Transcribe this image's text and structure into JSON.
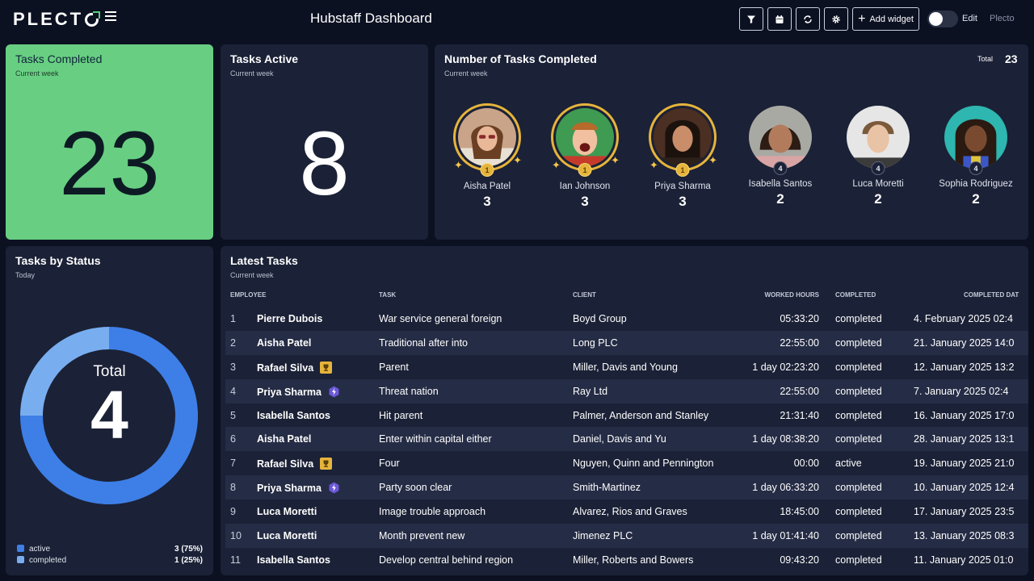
{
  "app": {
    "logo": "PLECTO",
    "dashboard_title": "Hubstaff Dashboard",
    "toolbar": {
      "filter_icon": "filter-icon",
      "calendar_icon": "calendar-icon",
      "refresh_icon": "refresh-icon",
      "settings_icon": "gear-icon",
      "add_widget_label": "Add widget",
      "edit_label": "Edit",
      "brand_label": "Plecto"
    }
  },
  "tasks_completed": {
    "title": "Tasks Completed",
    "subtitle": "Current week",
    "value": "23",
    "color": "#68cf82"
  },
  "tasks_active": {
    "title": "Tasks Active",
    "subtitle": "Current week",
    "value": "8"
  },
  "leaderboard": {
    "title": "Number of Tasks Completed",
    "subtitle": "Current week",
    "total_label": "Total",
    "total_value": "23",
    "people": [
      {
        "name": "Aisha Patel",
        "value": "3",
        "rank": "1"
      },
      {
        "name": "Ian Johnson",
        "value": "3",
        "rank": "1"
      },
      {
        "name": "Priya Sharma",
        "value": "3",
        "rank": "1"
      },
      {
        "name": "Isabella Santos",
        "value": "2",
        "rank": "4"
      },
      {
        "name": "Luca Moretti",
        "value": "2",
        "rank": "4"
      },
      {
        "name": "Sophia Rodriguez",
        "value": "2",
        "rank": "4"
      }
    ]
  },
  "status": {
    "title": "Tasks by Status",
    "subtitle": "Today",
    "total_label": "Total",
    "total_value": "4",
    "segments": [
      {
        "label": "active",
        "value": "3 (75%)",
        "fraction": 0.75,
        "color": "#3d7fe6"
      },
      {
        "label": "completed",
        "value": "1 (25%)",
        "fraction": 0.25,
        "color": "#78aef0"
      }
    ]
  },
  "latest_tasks": {
    "title": "Latest Tasks",
    "subtitle": "Current week",
    "columns": [
      "EMPLOYEE",
      "TASK",
      "CLIENT",
      "WORKED HOURS",
      "COMPLETED",
      "COMPLETED DAT"
    ],
    "rows": [
      {
        "idx": "1",
        "employee": "Pierre Dubois",
        "badge": "",
        "task": "War service general foreign",
        "client": "Boyd Group",
        "hours": "05:33:20",
        "completed": "completed",
        "date": "4. February 2025 02:4"
      },
      {
        "idx": "2",
        "employee": "Aisha Patel",
        "badge": "",
        "task": "Traditional after into",
        "client": "Long PLC",
        "hours": "22:55:00",
        "completed": "completed",
        "date": "21. January 2025 14:0"
      },
      {
        "idx": "3",
        "employee": "Rafael Silva",
        "badge": "trophy",
        "task": "Parent",
        "client": "Miller, Davis and Young",
        "hours": "1 day 02:23:20",
        "completed": "completed",
        "date": "12. January 2025 13:2"
      },
      {
        "idx": "4",
        "employee": "Priya Sharma",
        "badge": "bolt",
        "task": "Threat nation",
        "client": "Ray Ltd",
        "hours": "22:55:00",
        "completed": "completed",
        "date": "7. January 2025 02:4"
      },
      {
        "idx": "5",
        "employee": "Isabella Santos",
        "badge": "",
        "task": "Hit parent",
        "client": "Palmer, Anderson and Stanley",
        "hours": "21:31:40",
        "completed": "completed",
        "date": "16. January 2025 17:0"
      },
      {
        "idx": "6",
        "employee": "Aisha Patel",
        "badge": "",
        "task": "Enter within capital either",
        "client": "Daniel, Davis and Yu",
        "hours": "1 day 08:38:20",
        "completed": "completed",
        "date": "28. January 2025 13:1"
      },
      {
        "idx": "7",
        "employee": "Rafael Silva",
        "badge": "trophy",
        "task": "Four",
        "client": "Nguyen, Quinn and Pennington",
        "hours": "00:00",
        "completed": "active",
        "date": "19. January 2025 21:0"
      },
      {
        "idx": "8",
        "employee": "Priya Sharma",
        "badge": "bolt",
        "task": "Party soon clear",
        "client": "Smith-Martinez",
        "hours": "1 day 06:33:20",
        "completed": "completed",
        "date": "10. January 2025 12:4"
      },
      {
        "idx": "9",
        "employee": "Luca Moretti",
        "badge": "",
        "task": "Image trouble approach",
        "client": "Alvarez, Rios and Graves",
        "hours": "18:45:00",
        "completed": "completed",
        "date": "17. January 2025 23:5"
      },
      {
        "idx": "10",
        "employee": "Luca Moretti",
        "badge": "",
        "task": "Month prevent new",
        "client": "Jimenez PLC",
        "hours": "1 day 01:41:40",
        "completed": "completed",
        "date": "13. January 2025 08:3"
      },
      {
        "idx": "11",
        "employee": "Isabella Santos",
        "badge": "",
        "task": "Develop central behind region",
        "client": "Miller, Roberts and Bowers",
        "hours": "09:43:20",
        "completed": "completed",
        "date": "11. January 2025 01:0"
      }
    ]
  }
}
